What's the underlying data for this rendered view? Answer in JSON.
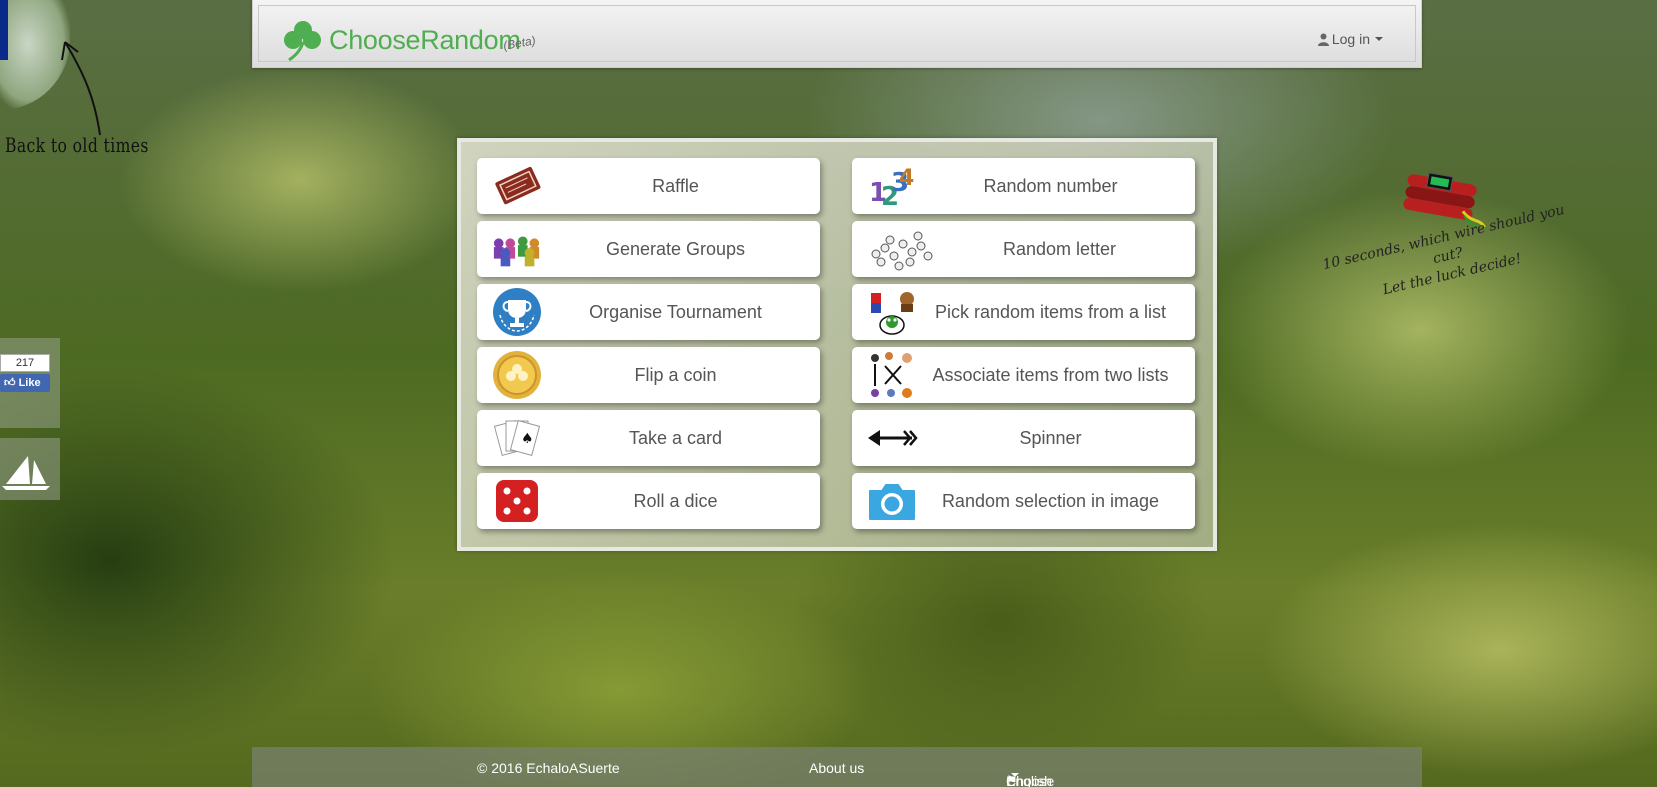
{
  "side": {
    "back_text": "Back to old times",
    "fb_count": "217",
    "fb_like": "Like"
  },
  "header": {
    "logo_text": "ChooseRandom",
    "logo_beta": "(Beta)",
    "login_label": "Log in"
  },
  "menu": {
    "left": [
      {
        "label": "Raffle",
        "icon": "ticket-icon"
      },
      {
        "label": "Generate Groups",
        "icon": "groups-icon"
      },
      {
        "label": "Organise Tournament",
        "icon": "trophy-icon"
      },
      {
        "label": "Flip a coin",
        "icon": "coin-icon"
      },
      {
        "label": "Take a card",
        "icon": "cards-icon"
      },
      {
        "label": "Roll a dice",
        "icon": "dice-icon"
      }
    ],
    "right": [
      {
        "label": "Random number",
        "icon": "numbers-icon"
      },
      {
        "label": "Random letter",
        "icon": "letters-icon"
      },
      {
        "label": "Pick random items from a list",
        "icon": "list-items-icon"
      },
      {
        "label": "Associate items from two lists",
        "icon": "associate-icon"
      },
      {
        "label": "Spinner",
        "icon": "arrow-icon"
      },
      {
        "label": "Random selection in image",
        "icon": "camera-icon"
      }
    ]
  },
  "promo": {
    "line1": "10 seconds, which wire should you cut?",
    "line2": "Let the luck decide!"
  },
  "footer": {
    "copyright": "© 2016 EchaloASuerte",
    "about": "About us",
    "language_prefix": "Choose language:",
    "language": "English"
  },
  "colors": {
    "brand_green": "#4fae50",
    "facebook_blue": "#4267b2",
    "camera_blue": "#3aa7e0",
    "dice_red": "#d42020"
  }
}
